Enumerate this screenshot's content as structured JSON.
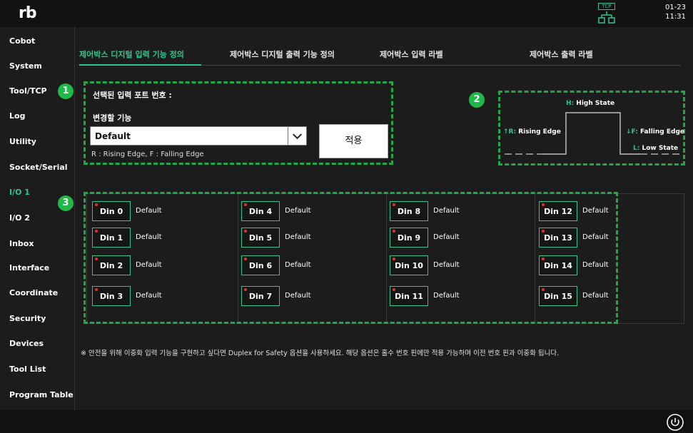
{
  "app": {
    "logo": "rb"
  },
  "status": {
    "tcp_label": "TCP",
    "date": "01-23",
    "time": "11:31"
  },
  "sidebar": {
    "items": [
      {
        "label": "Cobot",
        "active": false
      },
      {
        "label": "System",
        "active": false
      },
      {
        "label": "Tool/TCP",
        "active": false
      },
      {
        "label": "Log",
        "active": false
      },
      {
        "label": "Utility",
        "active": false
      },
      {
        "label": "Socket/Serial",
        "active": false
      },
      {
        "label": "I/O 1",
        "active": true
      },
      {
        "label": "I/O 2",
        "active": false
      },
      {
        "label": "Inbox",
        "active": false
      },
      {
        "label": "Interface",
        "active": false
      },
      {
        "label": "Coordinate",
        "active": false
      },
      {
        "label": "Security",
        "active": false
      },
      {
        "label": "Devices",
        "active": false
      },
      {
        "label": "Tool List",
        "active": false
      },
      {
        "label": "Program Table",
        "active": false
      }
    ]
  },
  "tabs": [
    {
      "label": "제어박스 디지털 입력 기능 정의",
      "active": true
    },
    {
      "label": "제어박스 디지털 출력 기능 정의",
      "active": false
    },
    {
      "label": "제어박스 입력 라벨",
      "active": false
    },
    {
      "label": "제어박스 출력 라벨",
      "active": false
    }
  ],
  "badges": [
    "1",
    "2",
    "3"
  ],
  "config": {
    "selected_port_label": "선택된 입력 포트 번호 :",
    "function_label": "변경할 기능",
    "function_value": "Default",
    "apply_label": "적용",
    "edge_note": "R : Rising Edge, F : Falling Edge"
  },
  "signal": {
    "high": {
      "letter": "H:",
      "text": "High State"
    },
    "rising": {
      "letter": "↑R:",
      "text": "Rising Edge"
    },
    "falling": {
      "letter": "↓F:",
      "text": "Falling Edge"
    },
    "low": {
      "letter": "L:",
      "text": "Low State"
    }
  },
  "inputs": [
    {
      "label": "Din 0",
      "func": "Default"
    },
    {
      "label": "Din 1",
      "func": "Default"
    },
    {
      "label": "Din 2",
      "func": "Default"
    },
    {
      "label": "Din 3",
      "func": "Default"
    },
    {
      "label": "Din 4",
      "func": "Default"
    },
    {
      "label": "Din 5",
      "func": "Default"
    },
    {
      "label": "Din 6",
      "func": "Default"
    },
    {
      "label": "Din 7",
      "func": "Default"
    },
    {
      "label": "Din 8",
      "func": "Default"
    },
    {
      "label": "Din 9",
      "func": "Default"
    },
    {
      "label": "Din 10",
      "func": "Default"
    },
    {
      "label": "Din 11",
      "func": "Default"
    },
    {
      "label": "Din 12",
      "func": "Default"
    },
    {
      "label": "Din 13",
      "func": "Default"
    },
    {
      "label": "Din 14",
      "func": "Default"
    },
    {
      "label": "Din 15",
      "func": "Default"
    }
  ],
  "footnote": "※ 안전을 위해 이중화 입력 기능을 구현하고 싶다면 Duplex for Safety 옵션을 사용하세요. 해당 옵션은 홀수 번호 핀에만 적용 가능하며 이전 번호 핀과 이중화 됩니다.",
  "colors": {
    "accent": "#31c48d",
    "badge": "#1fb84a",
    "dashed": "#1fa84a",
    "indicator": "#e53030"
  }
}
